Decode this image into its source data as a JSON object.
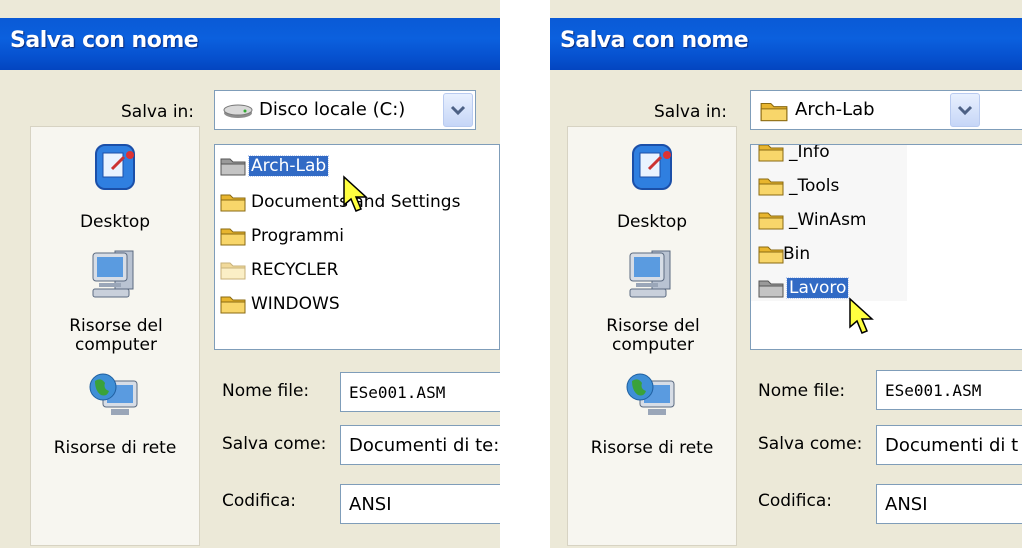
{
  "left": {
    "title": "Salva con nome",
    "save_in_label": "Salva in:",
    "save_in_value": "Disco locale (C:)",
    "places": [
      "Desktop",
      "Risorse del computer",
      "Risorse di rete"
    ],
    "items": [
      "Arch-Lab",
      "Documents and Settings",
      "Programmi",
      "RECYCLER",
      "WINDOWS"
    ],
    "selected_item": "Arch-Lab",
    "file_name_label": "Nome file:",
    "file_name_value": "ESe001.ASM",
    "save_as_label": "Salva come:",
    "save_as_value": "Documenti di te:",
    "encoding_label": "Codifica:",
    "encoding_value": "ANSI"
  },
  "right": {
    "title": "Salva con nome",
    "save_in_label": "Salva in:",
    "save_in_value": "Arch-Lab",
    "places": [
      "Desktop",
      "Risorse del computer",
      "Risorse di rete"
    ],
    "items": [
      "_Info",
      "_Tools",
      "_WinAsm",
      "Bin",
      "Lavoro"
    ],
    "selected_item": "Lavoro",
    "file_name_label": "Nome file:",
    "file_name_value": "ESe001.ASM",
    "save_as_label": "Salva come:",
    "save_as_value": "Documenti di t",
    "encoding_label": "Codifica:",
    "encoding_value": "ANSI"
  },
  "icons": {
    "places": [
      "desktop-icon",
      "my-computer-icon",
      "network-places-icon"
    ],
    "folder": "folder-icon",
    "drive": "hard-drive-icon",
    "cursor": "hand-pointer-cursor"
  },
  "colors": {
    "title_bar": "#0a5ad6",
    "dialog_bg": "#ece9d8",
    "selection": "#316ac5"
  }
}
